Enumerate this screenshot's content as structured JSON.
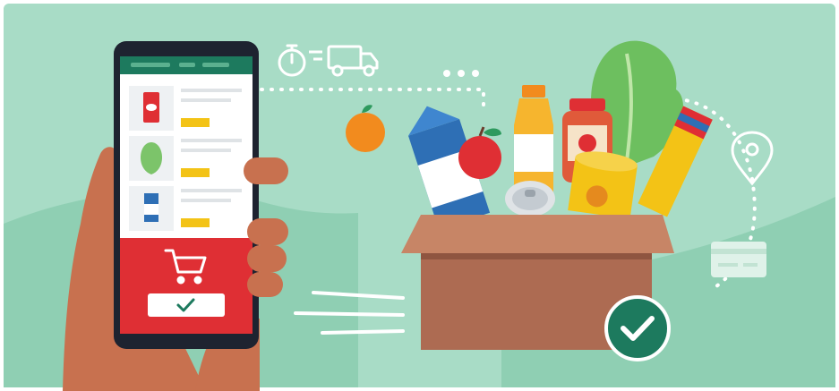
{
  "illustration": {
    "theme": "online grocery delivery",
    "colors": {
      "background": "#a8dcc6",
      "hill": "#8fcfb3",
      "phone_body": "#1e2330",
      "phone_header": "#1d7a5e",
      "cart_panel": "#df2f34",
      "price_tag": "#f3c316",
      "box": "#ad6b52",
      "check_badge": "#1d7a5e",
      "skin": "#c8714f"
    },
    "icons": [
      "stopwatch-icon",
      "delivery-truck-icon",
      "shopping-cart-icon",
      "checkmark-icon",
      "location-pin-icon",
      "credit-card-icon"
    ]
  }
}
